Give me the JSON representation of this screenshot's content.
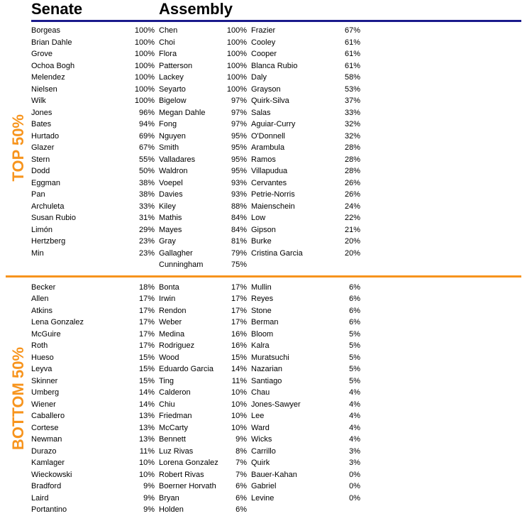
{
  "titles": {
    "senate": "Senate",
    "assembly": "Assembly",
    "top50": "TOP 50%",
    "bottom50": "BOTTOM 50%"
  },
  "top": {
    "senate": [
      {
        "name": "Borgeas",
        "pct": "100%"
      },
      {
        "name": "Brian Dahle",
        "pct": "100%"
      },
      {
        "name": "Grove",
        "pct": "100%"
      },
      {
        "name": "Ochoa Bogh",
        "pct": "100%"
      },
      {
        "name": "Melendez",
        "pct": "100%"
      },
      {
        "name": "Nielsen",
        "pct": "100%"
      },
      {
        "name": "Wilk",
        "pct": "100%"
      },
      {
        "name": "Jones",
        "pct": "96%"
      },
      {
        "name": "Bates",
        "pct": "94%"
      },
      {
        "name": "Hurtado",
        "pct": "69%"
      },
      {
        "name": "Glazer",
        "pct": "67%"
      },
      {
        "name": "Stern",
        "pct": "55%"
      },
      {
        "name": "Dodd",
        "pct": "50%"
      },
      {
        "name": "Eggman",
        "pct": "38%"
      },
      {
        "name": "Pan",
        "pct": "38%"
      },
      {
        "name": "Archuleta",
        "pct": "33%"
      },
      {
        "name": "Susan Rubio",
        "pct": "31%"
      },
      {
        "name": "Limón",
        "pct": "29%"
      },
      {
        "name": "Hertzberg",
        "pct": "23%"
      },
      {
        "name": "Min",
        "pct": "23%"
      }
    ],
    "assembly_left": [
      {
        "name": "Chen",
        "pct": "100%"
      },
      {
        "name": "Choi",
        "pct": "100%"
      },
      {
        "name": "Flora",
        "pct": "100%"
      },
      {
        "name": "Patterson",
        "pct": "100%"
      },
      {
        "name": "Lackey",
        "pct": "100%"
      },
      {
        "name": "Seyarto",
        "pct": "100%"
      },
      {
        "name": "Bigelow",
        "pct": "97%"
      },
      {
        "name": "Megan Dahle",
        "pct": "97%"
      },
      {
        "name": "Fong",
        "pct": "97%"
      },
      {
        "name": "Nguyen",
        "pct": "95%"
      },
      {
        "name": "Smith",
        "pct": "95%"
      },
      {
        "name": "Valladares",
        "pct": "95%"
      },
      {
        "name": "Waldron",
        "pct": "95%"
      },
      {
        "name": "Voepel",
        "pct": "93%"
      },
      {
        "name": "Davies",
        "pct": "93%"
      },
      {
        "name": "Kiley",
        "pct": "88%"
      },
      {
        "name": "Mathis",
        "pct": "84%"
      },
      {
        "name": "Mayes",
        "pct": "84%"
      },
      {
        "name": "Gray",
        "pct": "81%"
      },
      {
        "name": "Gallagher",
        "pct": "79%"
      },
      {
        "name": "Cunningham",
        "pct": "75%"
      }
    ],
    "assembly_right": [
      {
        "name": "Frazier",
        "pct": "67%"
      },
      {
        "name": "Cooley",
        "pct": "61%"
      },
      {
        "name": "Cooper",
        "pct": "61%"
      },
      {
        "name": "Blanca Rubio",
        "pct": "61%"
      },
      {
        "name": "Daly",
        "pct": "58%"
      },
      {
        "name": "Grayson",
        "pct": "53%"
      },
      {
        "name": "Quirk-Silva",
        "pct": "37%"
      },
      {
        "name": "Salas",
        "pct": "33%"
      },
      {
        "name": "Aguiar-Curry",
        "pct": "32%"
      },
      {
        "name": "O'Donnell",
        "pct": "32%"
      },
      {
        "name": "Arambula",
        "pct": "28%"
      },
      {
        "name": "Ramos",
        "pct": "28%"
      },
      {
        "name": "Villapudua",
        "pct": "28%"
      },
      {
        "name": "Cervantes",
        "pct": "26%"
      },
      {
        "name": "Petrie-Norris",
        "pct": "26%"
      },
      {
        "name": "Maienschein",
        "pct": "24%"
      },
      {
        "name": "Low",
        "pct": "22%"
      },
      {
        "name": "Gipson",
        "pct": "21%"
      },
      {
        "name": "Burke",
        "pct": "20%"
      },
      {
        "name": "Cristina Garcia",
        "pct": "20%"
      }
    ]
  },
  "bottom": {
    "senate": [
      {
        "name": "Becker",
        "pct": "18%"
      },
      {
        "name": "Allen",
        "pct": "17%"
      },
      {
        "name": "Atkins",
        "pct": "17%"
      },
      {
        "name": "Lena Gonzalez",
        "pct": "17%"
      },
      {
        "name": "McGuire",
        "pct": "17%"
      },
      {
        "name": "Roth",
        "pct": "17%"
      },
      {
        "name": "Hueso",
        "pct": "15%"
      },
      {
        "name": "Leyva",
        "pct": "15%"
      },
      {
        "name": "Skinner",
        "pct": "15%"
      },
      {
        "name": "Umberg",
        "pct": "14%"
      },
      {
        "name": "Wiener",
        "pct": "14%"
      },
      {
        "name": "Caballero",
        "pct": "13%"
      },
      {
        "name": "Cortese",
        "pct": "13%"
      },
      {
        "name": "Newman",
        "pct": "13%"
      },
      {
        "name": "Durazo",
        "pct": "11%"
      },
      {
        "name": "Kamlager",
        "pct": "10%"
      },
      {
        "name": "Wieckowski",
        "pct": "10%"
      },
      {
        "name": "Bradford",
        "pct": "9%"
      },
      {
        "name": "Laird",
        "pct": "9%"
      },
      {
        "name": "Portantino",
        "pct": "9%"
      }
    ],
    "assembly_left": [
      {
        "name": "Bonta",
        "pct": "17%"
      },
      {
        "name": "Irwin",
        "pct": "17%"
      },
      {
        "name": "Rendon",
        "pct": "17%"
      },
      {
        "name": "Weber",
        "pct": "17%"
      },
      {
        "name": "Medina",
        "pct": "16%"
      },
      {
        "name": "Rodriguez",
        "pct": "16%"
      },
      {
        "name": "Wood",
        "pct": "15%"
      },
      {
        "name": "Eduardo Garcia",
        "pct": "14%"
      },
      {
        "name": "Ting",
        "pct": "11%"
      },
      {
        "name": "Calderon",
        "pct": "10%"
      },
      {
        "name": "Chiu",
        "pct": "10%"
      },
      {
        "name": "Friedman",
        "pct": "10%"
      },
      {
        "name": "McCarty",
        "pct": "10%"
      },
      {
        "name": "Bennett",
        "pct": "9%"
      },
      {
        "name": "Luz Rivas",
        "pct": "8%"
      },
      {
        "name": "Lorena Gonzalez",
        "pct": "7%"
      },
      {
        "name": "Robert Rivas",
        "pct": "7%"
      },
      {
        "name": "Boerner Horvath",
        "pct": "6%"
      },
      {
        "name": "Bryan",
        "pct": "6%"
      },
      {
        "name": "Holden",
        "pct": "6%"
      }
    ],
    "assembly_right": [
      {
        "name": "Mullin",
        "pct": "6%"
      },
      {
        "name": "Reyes",
        "pct": "6%"
      },
      {
        "name": "Stone",
        "pct": "6%"
      },
      {
        "name": "Berman",
        "pct": "6%"
      },
      {
        "name": "Bloom",
        "pct": "5%"
      },
      {
        "name": "Kalra",
        "pct": "5%"
      },
      {
        "name": "Muratsuchi",
        "pct": "5%"
      },
      {
        "name": "Nazarian",
        "pct": "5%"
      },
      {
        "name": "Santiago",
        "pct": "5%"
      },
      {
        "name": "Chau",
        "pct": "4%"
      },
      {
        "name": "Jones-Sawyer",
        "pct": "4%"
      },
      {
        "name": "Lee",
        "pct": "4%"
      },
      {
        "name": "Ward",
        "pct": "4%"
      },
      {
        "name": "Wicks",
        "pct": "4%"
      },
      {
        "name": "Carrillo",
        "pct": "3%"
      },
      {
        "name": "Quirk",
        "pct": "3%"
      },
      {
        "name": "Bauer-Kahan",
        "pct": "0%"
      },
      {
        "name": "Gabriel",
        "pct": "0%"
      },
      {
        "name": "Levine",
        "pct": "0%"
      }
    ]
  }
}
